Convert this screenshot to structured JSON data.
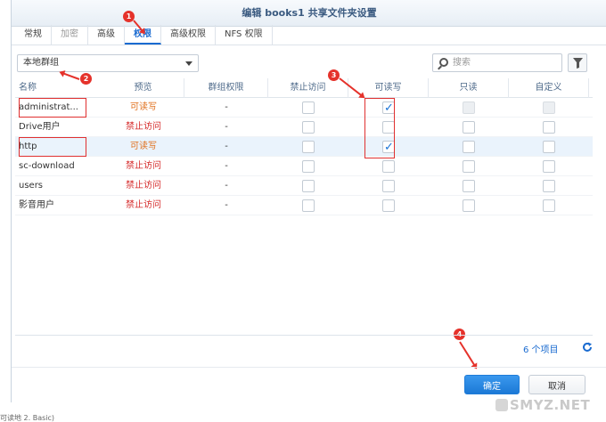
{
  "dialog": {
    "title": "编辑 books1 共享文件夹设置"
  },
  "tabs": [
    {
      "label": "常规"
    },
    {
      "label": "加密"
    },
    {
      "label": "高级"
    },
    {
      "label": "权限"
    },
    {
      "label": "高级权限"
    },
    {
      "label": "NFS 权限"
    }
  ],
  "active_tab": "权限",
  "group_select": {
    "value": "本地群组"
  },
  "search": {
    "placeholder": "搜索"
  },
  "columns": {
    "name": "名称",
    "preview": "预览",
    "group_perm": "群组权限",
    "deny": "禁止访问",
    "read_write": "可读写",
    "read_only": "只读",
    "custom": "自定义"
  },
  "rows": [
    {
      "name": "administrat...",
      "preview": "可读写",
      "group_perm": "-",
      "deny": false,
      "read_write": true,
      "read_only": false,
      "read_only_disabled": true,
      "custom": false,
      "custom_disabled": true
    },
    {
      "name": "Drive用户",
      "preview": "禁止访问",
      "group_perm": "-",
      "deny": false,
      "read_write": false,
      "read_only": false,
      "custom": false
    },
    {
      "name": "http",
      "preview": "可读写",
      "group_perm": "-",
      "deny": false,
      "read_write": true,
      "read_only": false,
      "custom": false
    },
    {
      "name": "sc-download",
      "preview": "禁止访问",
      "group_perm": "-",
      "deny": false,
      "read_write": false,
      "read_only": false,
      "custom": false
    },
    {
      "name": "users",
      "preview": "禁止访问",
      "group_perm": "-",
      "deny": false,
      "read_write": false,
      "read_only": false,
      "custom": false
    },
    {
      "name": "影音用户",
      "preview": "禁止访问",
      "group_perm": "-",
      "deny": false,
      "read_write": false,
      "read_only": false,
      "custom": false
    }
  ],
  "item_count": "6 个项目",
  "buttons": {
    "ok": "确定",
    "cancel": "取消"
  },
  "annotations": [
    "1",
    "2",
    "3",
    "4"
  ],
  "below_text": "可读地 2. Basic)",
  "watermark": "SMYZ.NET",
  "colors": {
    "accent": "#1a6bd0",
    "read_write_text": "#e0701d",
    "deny_text": "#d52a2a",
    "annotation_red": "#e5322b"
  }
}
